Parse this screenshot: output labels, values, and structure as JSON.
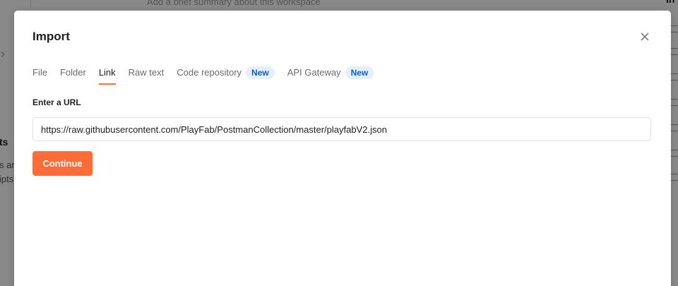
{
  "background": {
    "workspace_summary": "Add a brief summary about this workspace",
    "left_heading": "ts",
    "left_text_1": "s and",
    "left_text_2": "ipts",
    "right_heading": "In"
  },
  "modal": {
    "title": "Import",
    "close_icon": "close-icon",
    "tabs": [
      {
        "label": "File",
        "active": false,
        "badge": ""
      },
      {
        "label": "Folder",
        "active": false,
        "badge": ""
      },
      {
        "label": "Link",
        "active": true,
        "badge": ""
      },
      {
        "label": "Raw text",
        "active": false,
        "badge": ""
      },
      {
        "label": "Code repository",
        "active": false,
        "badge": "New"
      },
      {
        "label": "API Gateway",
        "active": false,
        "badge": "New"
      }
    ],
    "url_label": "Enter a URL",
    "url_value": "https://raw.githubusercontent.com/PlayFab/PostmanCollection/master/playfabV2.json",
    "continue_label": "Continue"
  },
  "colors": {
    "accent": "#ff6c37",
    "badge_text": "#0b5ed7",
    "badge_bg": "#e6efff"
  }
}
